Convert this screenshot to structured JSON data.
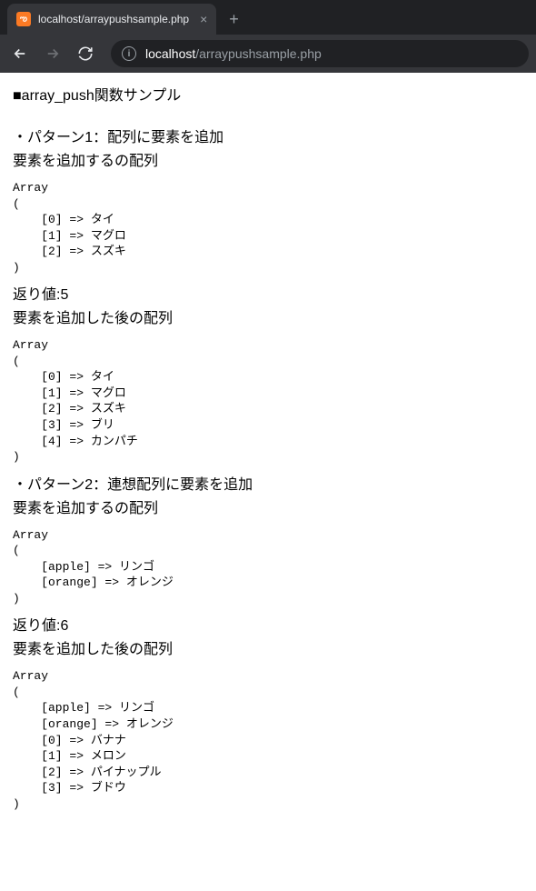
{
  "browser": {
    "tab_title": "localhost/arraypushsample.php",
    "url_host": "localhost",
    "url_path": "/arraypushsample.php"
  },
  "page": {
    "heading": "■array_push関数サンプル",
    "pattern1_title": "・パターン1：配列に要素を追加",
    "before_label": "要素を追加するの配列",
    "pre1": "Array\n(\n    [0] => タイ\n    [1] => マグロ\n    [2] => スズキ\n)",
    "return1": "返り値:5",
    "after_label": "要素を追加した後の配列",
    "pre2": "Array\n(\n    [0] => タイ\n    [1] => マグロ\n    [2] => スズキ\n    [3] => ブリ\n    [4] => カンパチ\n)",
    "pattern2_title": "・パターン2：連想配列に要素を追加",
    "pre3": "Array\n(\n    [apple] => リンゴ\n    [orange] => オレンジ\n)",
    "return2": "返り値:6",
    "pre4": "Array\n(\n    [apple] => リンゴ\n    [orange] => オレンジ\n    [0] => バナナ\n    [1] => メロン\n    [2] => パイナップル\n    [3] => ブドウ\n)"
  }
}
